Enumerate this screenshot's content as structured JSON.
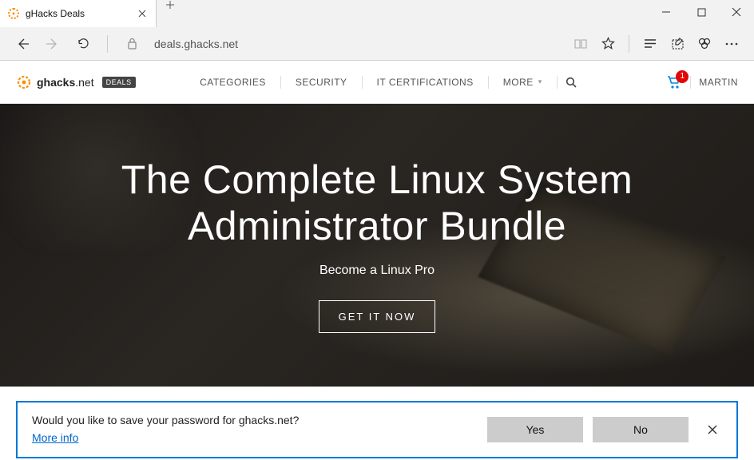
{
  "browser": {
    "tab_title": "gHacks Deals",
    "url": "deals.ghacks.net"
  },
  "site": {
    "logo_name": "ghacks",
    "logo_suffix": ".net",
    "logo_badge": "DEALS",
    "nav": {
      "categories": "CATEGORIES",
      "security": "SECURITY",
      "it_certifications": "IT CERTIFICATIONS",
      "more": "MORE"
    },
    "cart_count": "1",
    "user": "MARTIN"
  },
  "hero": {
    "title_line1": "The Complete Linux System",
    "title_line2": "Administrator Bundle",
    "subtitle": "Become a Linux Pro",
    "cta": "GET IT NOW"
  },
  "prompt": {
    "message": "Would you like to save your password for ghacks.net?",
    "more": "More info",
    "yes": "Yes",
    "no": "No"
  }
}
